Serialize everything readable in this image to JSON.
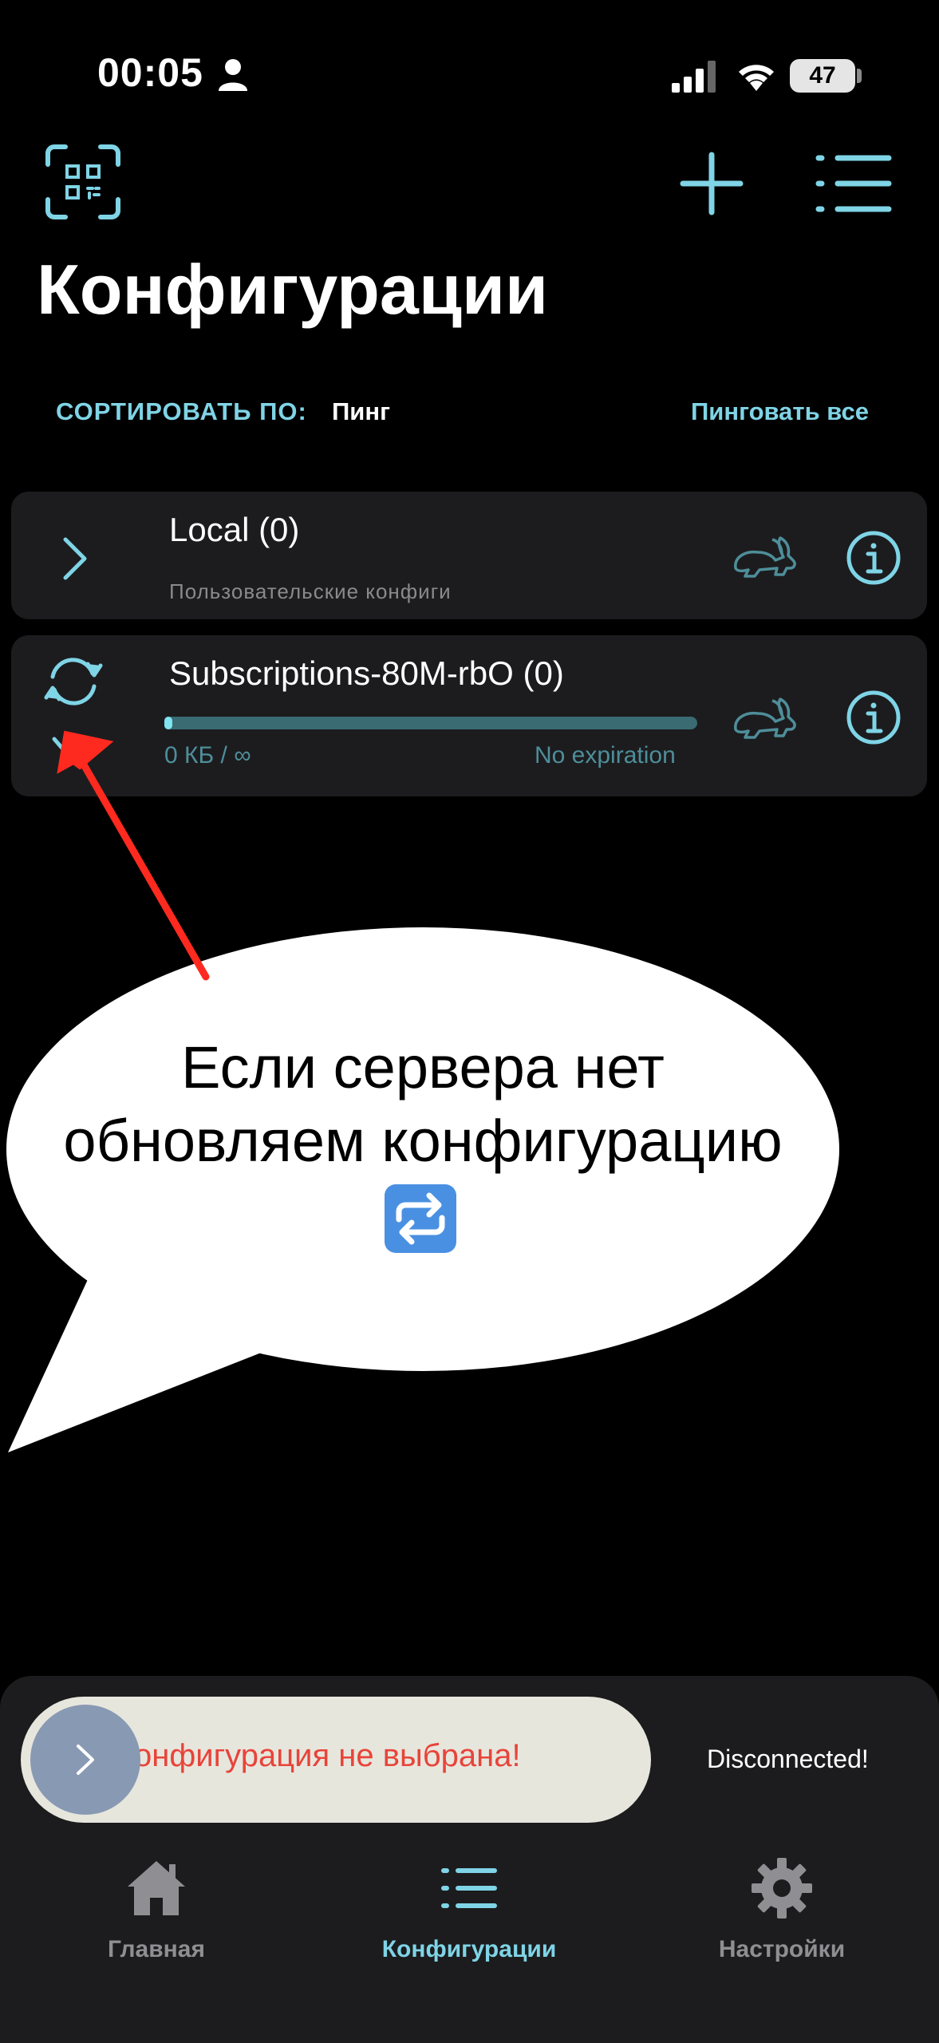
{
  "status_bar": {
    "time": "00:05",
    "battery": "47"
  },
  "header": {
    "title": "Конфигурации"
  },
  "sort": {
    "label": "СОРТИРОВАТЬ ПО:",
    "value": "Пинг",
    "ping_all": "Пинговать все"
  },
  "groups": [
    {
      "title": "Local (0)",
      "subtitle": "Пользовательские конфиги"
    },
    {
      "title": "Subscriptions-80M-rbO (0)",
      "usage": "0 КБ / ∞",
      "expiration": "No expiration",
      "progress": 0.01
    }
  ],
  "annotation": {
    "line1": "Если сервера нет",
    "line2": "обновляем конфигурацию",
    "emoji": "🔁"
  },
  "connection": {
    "banner": "онфигурация не выбрана!",
    "status": "Disconnected!"
  },
  "nav": {
    "home": "Главная",
    "configs": "Конфигурации",
    "settings": "Настройки"
  },
  "colors": {
    "accent": "#7fd4e6",
    "error": "#e8443a",
    "annotation_arrow": "#ff2a1f"
  }
}
